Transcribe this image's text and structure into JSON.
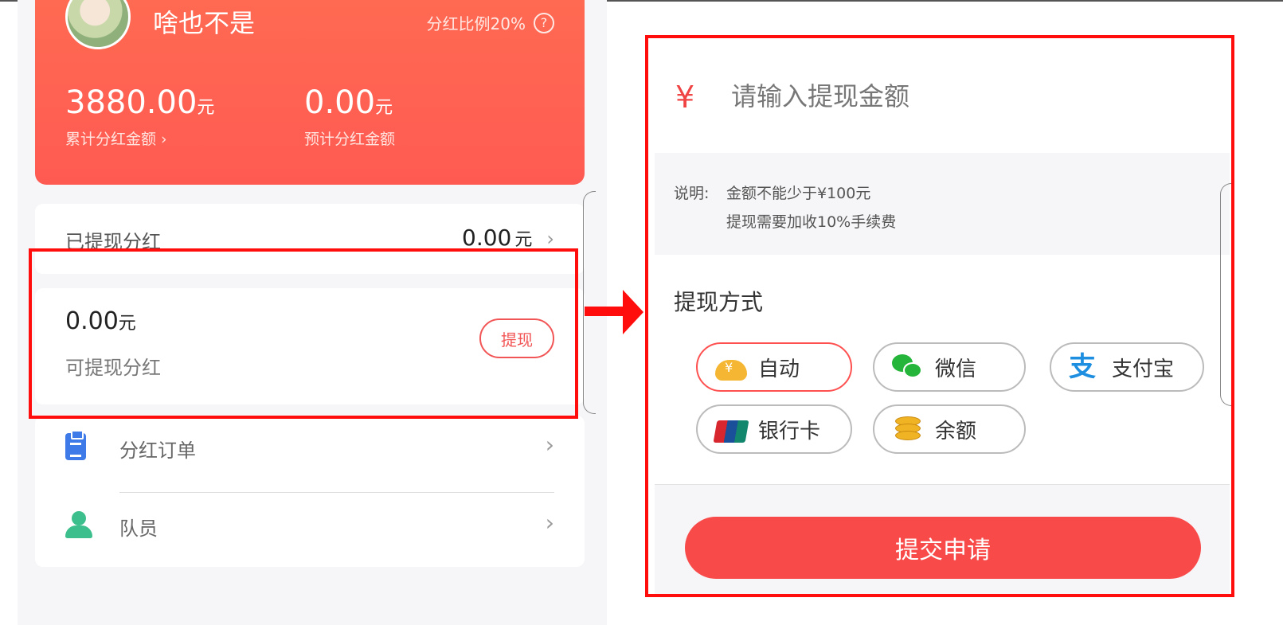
{
  "left": {
    "header": {
      "username": "啥也不是",
      "ratio_label": "分红比例20%",
      "help_icon": "question-circle-icon",
      "total": {
        "amount": "3880.00",
        "unit": "元",
        "caption": "累计分红金额 ›"
      },
      "estimated": {
        "amount": "0.00",
        "unit": "元",
        "caption": "预计分红金额"
      }
    },
    "withdrawn": {
      "label": "已提现分红",
      "amount": "0.00",
      "unit": "元",
      "chevron": "›"
    },
    "available": {
      "amount": "0.00",
      "unit": "元",
      "caption": "可提现分红",
      "button": "提现"
    },
    "menu": [
      {
        "label": "分红订单",
        "icon": "clipboard-icon",
        "chevron": "›"
      },
      {
        "label": "队员",
        "icon": "team-icon",
        "chevron": "›"
      }
    ]
  },
  "right": {
    "currency_symbol": "¥",
    "amount_placeholder": "请输入提现金额",
    "note": {
      "label": "说明:",
      "line1": "金额不能少于¥100元",
      "line2": "提现需要加收10%手续费"
    },
    "method_title": "提现方式",
    "methods": [
      {
        "label": "自动",
        "icon": "cloud-yen-icon",
        "selected": true
      },
      {
        "label": "微信",
        "icon": "wechat-icon",
        "selected": false
      },
      {
        "label": "支付宝",
        "icon": "alipay-icon",
        "selected": false
      },
      {
        "label": "银行卡",
        "icon": "unionpay-icon",
        "selected": false
      },
      {
        "label": "余额",
        "icon": "coins-icon",
        "selected": false
      }
    ],
    "submit": "提交申请"
  },
  "colors": {
    "accent_red": "#f94a4a",
    "highlight_red": "#ff0d0d",
    "header_gradient": "#ff6a52"
  }
}
